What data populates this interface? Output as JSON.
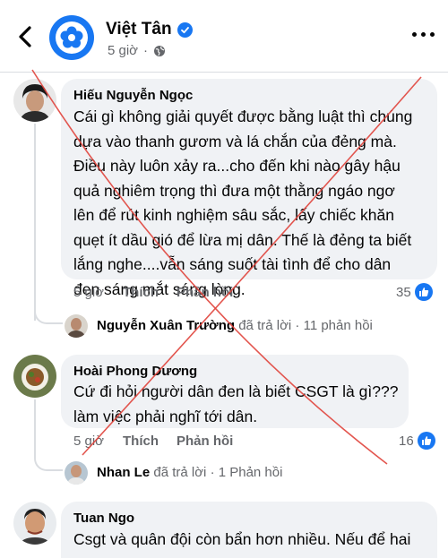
{
  "header": {
    "page_name": "Việt Tân",
    "time": "5 giờ"
  },
  "comments": [
    {
      "author": "Hiếu Nguyễn Ngọc",
      "lines": [
        "Cái gì không giải quyết được bằng luật thì chúng",
        "dựa vào thanh gươm và lá chắn của đẻng mà.",
        "Điều này luôn xảy ra...cho đến khi nào gây hậu",
        "quả nghiêm trọng thì đưa một thằng ngáo ngơ",
        "lên để rút kinh nghiệm sâu sắc, lấy chiếc khăn",
        "quẹt ít dầu gió để lừa mị dân. Thế là đẻng ta biết",
        "lắng nghe....vẫn sáng suốt tài tình để cho dân",
        "đen sáng mắt sáng lòng."
      ],
      "time": "5 giờ",
      "like_label": "Thích",
      "reply_label": "Phản hồi",
      "likes": "35",
      "reply": {
        "name": "Nguyễn Xuân Trường",
        "action": "đã trả lời",
        "count": "· 11 phản hồi"
      }
    },
    {
      "author": "Hoài Phong Dương",
      "lines": [
        "Cứ đi hỏi người dân đen là biết CSGT là gì???",
        "làm việc phải nghĩ tới dân."
      ],
      "time": "5 giờ",
      "like_label": "Thích",
      "reply_label": "Phản hồi",
      "likes": "16",
      "reply": {
        "name": "Nhan Le",
        "action": "đã trả lời",
        "count": "· 1 Phản hồi"
      }
    },
    {
      "author": "Tuan Ngo",
      "lines": [
        "Csgt và quân đội còn bẩn hơn nhiều. Nếu để hai"
      ]
    }
  ],
  "colors": {
    "accent": "#1877f2",
    "bubble": "#f0f2f5",
    "secondary_text": "#65676b",
    "overlay_cross": "#e0443c"
  }
}
